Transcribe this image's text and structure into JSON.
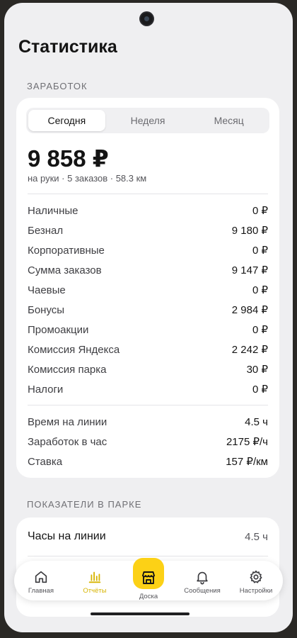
{
  "page": {
    "title": "Статистика"
  },
  "earnings": {
    "section_label": "ЗАРАБОТОК",
    "periods": [
      "Сегодня",
      "Неделя",
      "Месяц"
    ],
    "selected_period": "Сегодня",
    "total": "9 858 ₽",
    "summary": "на руки · 5 заказов · 58.3 км",
    "rows": [
      {
        "label": "Наличные",
        "value": "0 ₽"
      },
      {
        "label": "Безнал",
        "value": "9 180 ₽"
      },
      {
        "label": "Корпоративные",
        "value": "0 ₽"
      },
      {
        "label": "Сумма заказов",
        "value": "9 147 ₽"
      },
      {
        "label": "Чаевые",
        "value": "0 ₽"
      },
      {
        "label": "Бонусы",
        "value": "2 984 ₽"
      },
      {
        "label": "Промоакции",
        "value": "0 ₽"
      },
      {
        "label": "Комиссия Яндекса",
        "value": "2 242 ₽"
      },
      {
        "label": "Комиссия парка",
        "value": "30 ₽"
      },
      {
        "label": "Налоги",
        "value": "0 ₽"
      }
    ],
    "metrics": [
      {
        "label": "Время на линии",
        "value": "4.5 ч"
      },
      {
        "label": "Заработок в час",
        "value": "2175 ₽/ч"
      },
      {
        "label": "Ставка",
        "value": "157 ₽/км"
      }
    ]
  },
  "park": {
    "section_label": "ПОКАЗАТЕЛИ В ПАРКЕ",
    "rows": [
      {
        "label": "Часы на линии",
        "value": "4.5 ч"
      }
    ]
  },
  "tabbar": {
    "items": [
      {
        "label": "Главная",
        "icon": "home-icon"
      },
      {
        "label": "Отчёты",
        "icon": "bar-chart-icon",
        "active": true
      },
      {
        "label": "Доска",
        "icon": "storefront-icon",
        "center": true
      },
      {
        "label": "Сообщения",
        "icon": "bell-icon"
      },
      {
        "label": "Настройки",
        "icon": "gear-icon"
      }
    ],
    "accent_color": "#fcd116",
    "active_color": "#d7b400"
  }
}
